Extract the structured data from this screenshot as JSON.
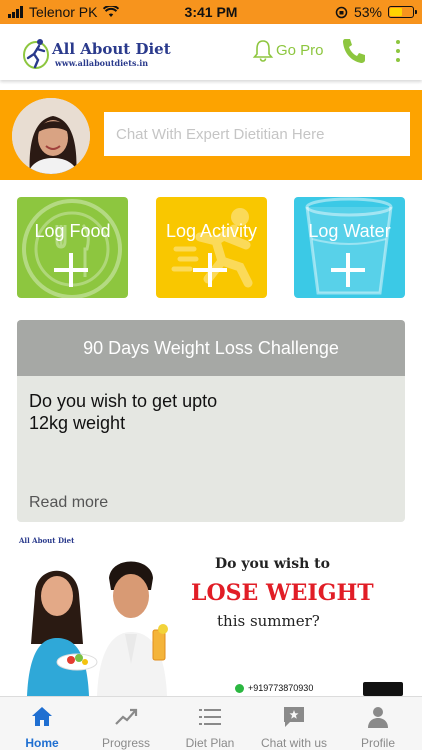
{
  "status_bar": {
    "carrier": "Telenor PK",
    "time": "3:41 PM",
    "battery_percent": "53%",
    "battery_level": 0.53
  },
  "header": {
    "logo_name": "All About Diet",
    "logo_url": "www.allaboutdiets.in",
    "go_pro_label": "Go Pro",
    "icons": [
      "bell-icon",
      "phone-icon",
      "more-vertical-icon"
    ]
  },
  "chat": {
    "placeholder": "Chat With Expert Dietitian Here"
  },
  "log_tiles": [
    {
      "label": "Log Food",
      "color": "#8dc63f"
    },
    {
      "label": "Log Activity",
      "color": "#f9c700"
    },
    {
      "label": "Log Water",
      "color": "#3bc9e6"
    }
  ],
  "challenge": {
    "title": "90 Days Weight Loss Challenge",
    "body_line1": "Do you wish to get upto",
    "body_line2": "12kg weight",
    "read_more": "Read more"
  },
  "banner": {
    "brand": "All About Diet",
    "line1": "Do you wish to",
    "line2": "LOSE WEIGHT",
    "line3": "this summer?",
    "phone": "+919773870930"
  },
  "tab_bar": {
    "items": [
      {
        "label": "Home",
        "icon": "home-icon",
        "active": true
      },
      {
        "label": "Progress",
        "icon": "trend-icon",
        "active": false
      },
      {
        "label": "Diet Plan",
        "icon": "list-icon",
        "active": false
      },
      {
        "label": "Chat with us",
        "icon": "chat-icon",
        "active": false
      },
      {
        "label": "Profile",
        "icon": "person-icon",
        "active": false
      }
    ]
  },
  "colors": {
    "status_bar": "#f7941d",
    "chat_band": "#fda300",
    "brand_green": "#8dc63f",
    "active_tab": "#1f6fd1"
  }
}
